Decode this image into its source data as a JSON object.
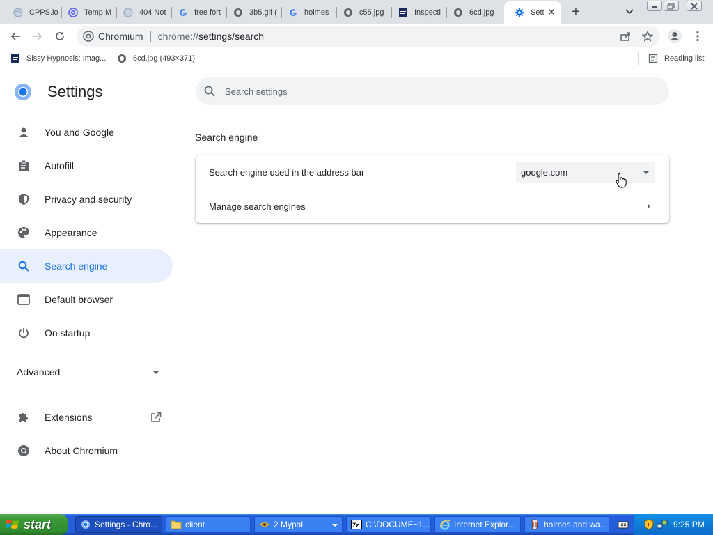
{
  "browser": {
    "tabs": [
      {
        "title": "CPPS.io",
        "icon": "globe-icon"
      },
      {
        "title": "Temp M",
        "icon": "at-sign-icon"
      },
      {
        "title": "404 Not",
        "icon": "globe-icon"
      },
      {
        "title": "free fort",
        "icon": "google-icon"
      },
      {
        "title": "3b5.gif (",
        "icon": "globe-icon"
      },
      {
        "title": "holmes",
        "icon": "google-icon"
      },
      {
        "title": "c55.jpg",
        "icon": "globe-icon"
      },
      {
        "title": "Inspecti",
        "icon": "site-icon"
      },
      {
        "title": "6cd.jpg",
        "icon": "globe-icon"
      },
      {
        "title": "Setti",
        "icon": "gear-icon",
        "active": true
      }
    ],
    "omnibox": {
      "site_chip": "Chromium",
      "url_prefix": "chrome://",
      "url_path": "settings/search"
    },
    "bookmarks": [
      {
        "label": "Sissy Hypnosis: Imag...",
        "icon": "site-icon"
      },
      {
        "label": "6cd.jpg (493×371)",
        "icon": "globe-icon"
      }
    ],
    "reading_list": "Reading list"
  },
  "settings": {
    "title": "Settings",
    "search_placeholder": "Search settings",
    "nav": [
      {
        "label": "You and Google",
        "icon": "person-icon"
      },
      {
        "label": "Autofill",
        "icon": "clipboard-icon"
      },
      {
        "label": "Privacy and security",
        "icon": "shield-icon"
      },
      {
        "label": "Appearance",
        "icon": "palette-icon"
      },
      {
        "label": "Search engine",
        "icon": "search-icon",
        "selected": true
      },
      {
        "label": "Default browser",
        "icon": "browser-icon"
      },
      {
        "label": "On startup",
        "icon": "power-icon"
      }
    ],
    "advanced": "Advanced",
    "extensions": "Extensions",
    "about": "About Chromium",
    "section_title": "Search engine",
    "rows": {
      "engine_label": "Search engine used in the address bar",
      "engine_value": "google.com",
      "manage_label": "Manage search engines"
    },
    "accent_color": "#1a73e8"
  },
  "taskbar": {
    "start": "start",
    "tasks": [
      {
        "label": "Settings - Chro...",
        "icon": "chromium-icon",
        "active": true
      },
      {
        "label": "client",
        "icon": "folder-icon"
      },
      {
        "label": "2 Mypal",
        "icon": "mypal-icon",
        "group": true
      },
      {
        "label": "C:\\DOCUME~1...",
        "icon": "7zip-icon"
      },
      {
        "label": "Internet Explor...",
        "icon": "ie-icon"
      },
      {
        "label": "holmes and wa...",
        "icon": "app-icon"
      }
    ],
    "clock": "9:25 PM"
  }
}
